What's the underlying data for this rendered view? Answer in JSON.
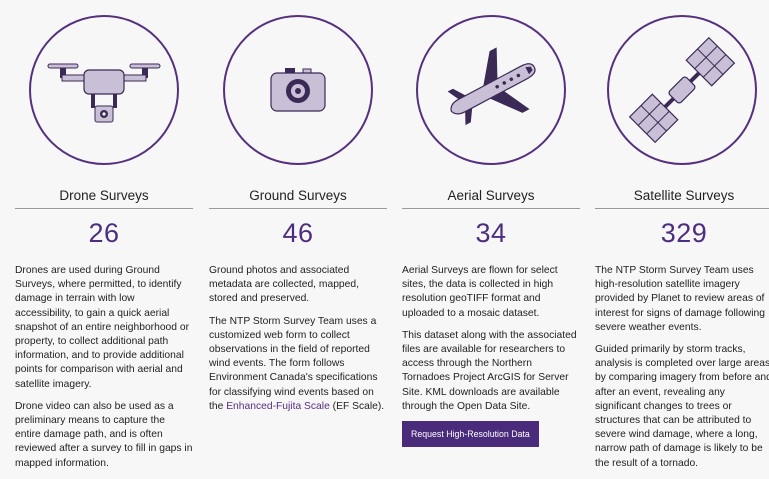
{
  "colors": {
    "accent": "#4d2d80",
    "icon_fill": "#c9c0d7",
    "background": "#f7f7f7"
  },
  "surveys": [
    {
      "icon": "drone-icon",
      "title": "Drone Surveys",
      "count": "26",
      "paragraphs": [
        "Drones are used during Ground Surveys, where permitted, to identify damage in terrain with low accessibility, to gain a quick aerial snapshot of an entire neighborhood or property, to collect additional path information, and to provide additional points for comparison with aerial and satellite imagery.",
        "Drone video can also be used as a preliminary means to capture the entire damage path, and is often reviewed after a survey to fill in gaps in mapped information."
      ]
    },
    {
      "icon": "camera-icon",
      "title": "Ground Surveys",
      "count": "46",
      "paragraphs": [
        "Ground photos and associated metadata are collected, mapped, stored and preserved."
      ],
      "p2_before": "The NTP Storm Survey Team uses a customized web form to collect observations in the field of reported wind events. The form follows Environment Canada's specifications for classifying wind events based on the ",
      "p2_link": "Enhanced-Fujita Scale",
      "p2_after": " (EF Scale)."
    },
    {
      "icon": "airplane-icon",
      "title": "Aerial Surveys",
      "count": "34",
      "paragraphs": [
        "Aerial Surveys are flown for select sites, the data is collected in high resolution geoTIFF format and uploaded to a mosaic dataset.",
        "This dataset along with the associated files are available for researchers to access through the Northern Tornadoes Project ArcGIS for Server Site. KML downloads are available through the Open Data Site."
      ],
      "button_label": "Request High-Resolution Data"
    },
    {
      "icon": "satellite-icon",
      "title": "Satellite Surveys",
      "count": "329",
      "paragraphs": [
        "The NTP Storm Survey Team uses high-resolution satellite imagery provided by Planet to review areas of interest for signs of damage following severe weather events.",
        "Guided primarily by storm tracks, analysis is completed over large areas by comparing imagery from before and after an event, revealing any significant changes to trees or structures that can be attributed to severe wind damage, where a long, narrow path of damage is likely to be the result of a tornado."
      ]
    }
  ]
}
